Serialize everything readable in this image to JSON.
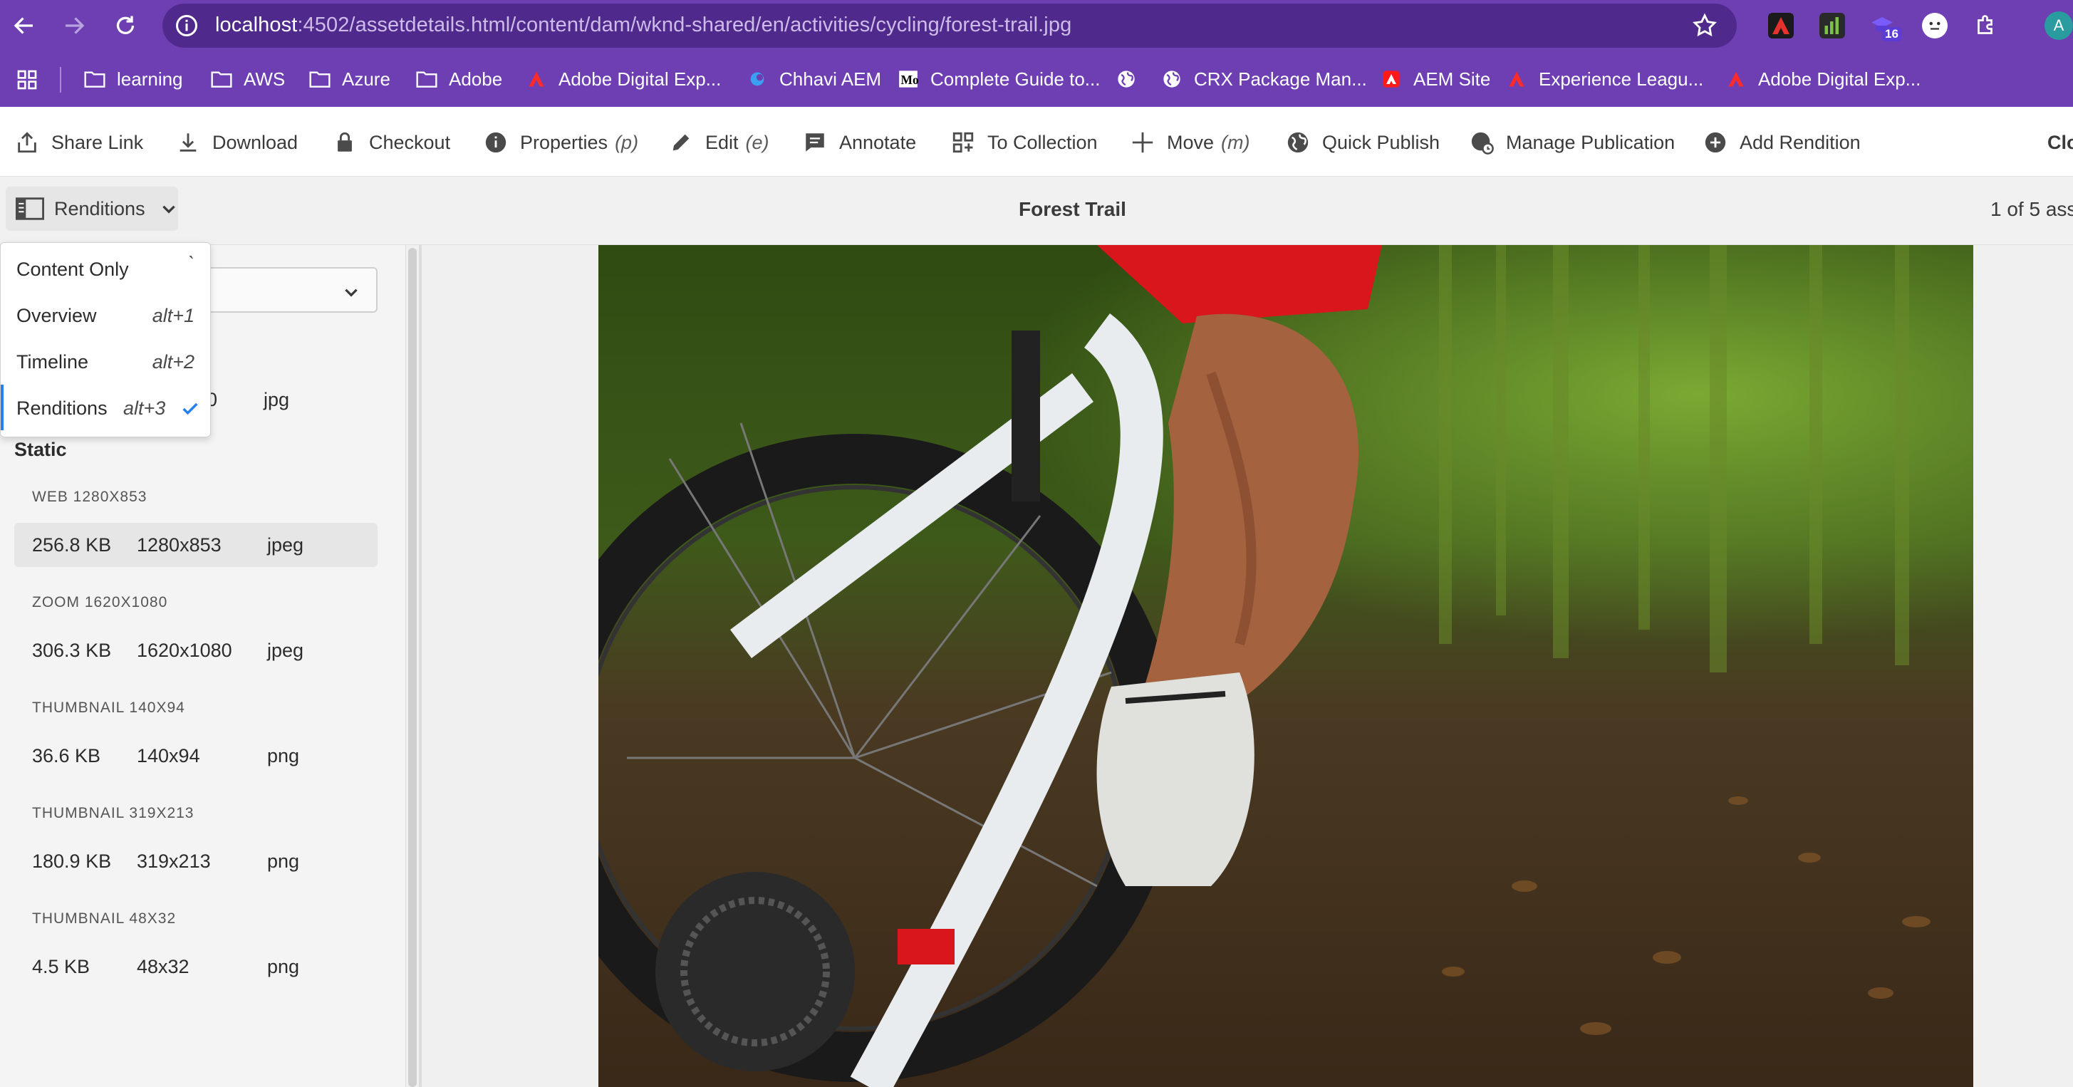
{
  "browser": {
    "url_host": "localhost",
    "url_path": ":4502/assetdetails.html/content/dam/wknd-shared/en/activities/cycling/forest-trail.jpg",
    "extension_badge_count": "16",
    "profile_initial": "A"
  },
  "bookmarks": [
    {
      "label": "learning",
      "icon": "folder-icon"
    },
    {
      "label": "AWS",
      "icon": "folder-icon"
    },
    {
      "label": "Azure",
      "icon": "folder-icon"
    },
    {
      "label": "Adobe",
      "icon": "folder-icon"
    },
    {
      "label": "Adobe Digital Exp...",
      "icon": "adobe-icon"
    },
    {
      "label": "Chhavi AEM",
      "icon": "site-icon"
    },
    {
      "label": "Complete Guide to...",
      "icon": "medium-icon"
    },
    {
      "label": "",
      "icon": "globe-icon"
    },
    {
      "label": "CRX Package Man...",
      "icon": "globe-icon"
    },
    {
      "label": "AEM Site",
      "icon": "adobe-icon"
    },
    {
      "label": "Experience Leagu...",
      "icon": "adobe-icon"
    },
    {
      "label": "Adobe Digital Exp...",
      "icon": "adobe-icon"
    }
  ],
  "toolbar": {
    "share_link": "Share Link",
    "download": "Download",
    "checkout": "Checkout",
    "properties": "Properties",
    "properties_key": "(p)",
    "edit": "Edit",
    "edit_key": "(e)",
    "annotate": "Annotate",
    "to_collection": "To Collection",
    "move": "Move",
    "move_key": "(m)",
    "quick_publish": "Quick Publish",
    "manage_publication": "Manage Publication",
    "add_rendition": "Add Rendition",
    "close": "Clo"
  },
  "titlebar": {
    "rail_toggle_label": "Renditions",
    "asset_title": "Forest Trail",
    "asset_count": "1 of 5 asse"
  },
  "view_menu": {
    "items": [
      {
        "label": "Content Only",
        "shortcut": "`"
      },
      {
        "label": "Overview",
        "shortcut": "alt+1"
      },
      {
        "label": "Timeline",
        "shortcut": "alt+2"
      },
      {
        "label": "Renditions",
        "shortcut": "alt+3",
        "selected": true
      }
    ]
  },
  "renditions": {
    "original_partial": {
      "dims_tail": "0",
      "format": "jpg"
    },
    "static_label": "Static",
    "items": [
      {
        "heading": "WEB 1280X853",
        "size": "256.8 KB",
        "dims": "1280x853",
        "format": "jpeg",
        "selected": true
      },
      {
        "heading": "ZOOM 1620X1080",
        "size": "306.3 KB",
        "dims": "1620x1080",
        "format": "jpeg"
      },
      {
        "heading": "THUMBNAIL 140X94",
        "size": "36.6 KB",
        "dims": "140x94",
        "format": "png"
      },
      {
        "heading": "THUMBNAIL 319X213",
        "size": "180.9 KB",
        "dims": "319x213",
        "format": "png"
      },
      {
        "heading": "THUMBNAIL 48X32",
        "size": "4.5 KB",
        "dims": "48x32",
        "format": "png"
      }
    ]
  },
  "colors": {
    "chrome": "#6d3fb2",
    "accent": "#2680eb"
  }
}
